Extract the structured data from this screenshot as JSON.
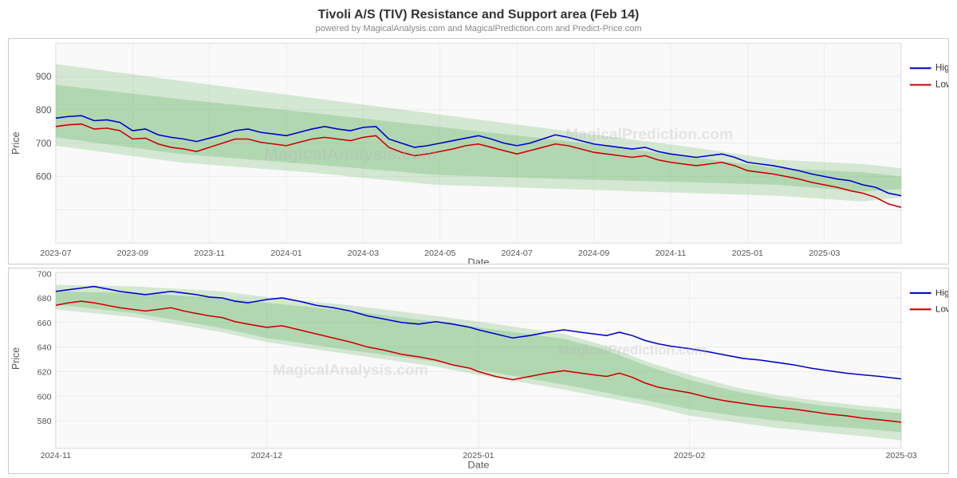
{
  "title": "Tivoli A/S (TIV) Resistance and Support area (Feb 14)",
  "subtitle": "powered by MagicalAnalysis.com and MagicalPrediction.com and Predict-Price.com",
  "watermark1": "MagicalAnalysis.com",
  "watermark2": "MagicalPrediction.com",
  "top_chart": {
    "y_label": "Price",
    "x_label": "Date",
    "y_ticks": [
      "900",
      "800",
      "700",
      "600"
    ],
    "x_ticks": [
      "2023-07",
      "2023-09",
      "2023-11",
      "2024-01",
      "2024-03",
      "2024-05",
      "2024-07",
      "2024-09",
      "2024-11",
      "2025-01",
      "2025-03"
    ],
    "legend": [
      {
        "label": "High",
        "color": "#0000cc"
      },
      {
        "label": "Low",
        "color": "#cc0000"
      }
    ]
  },
  "bottom_chart": {
    "y_label": "Price",
    "x_label": "Date",
    "y_ticks": [
      "700",
      "680",
      "660",
      "640",
      "620",
      "600",
      "580"
    ],
    "x_ticks": [
      "2024-11",
      "2024-12",
      "2025-01",
      "2025-02",
      "2025-03"
    ],
    "legend": [
      {
        "label": "High",
        "color": "#0000cc"
      },
      {
        "label": "Low",
        "color": "#cc0000"
      }
    ]
  }
}
